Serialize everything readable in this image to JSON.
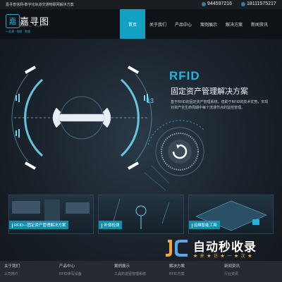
{
  "topbar": {
    "slogan": "嘉寻普信网-数字化轨道交通物联网解决方案",
    "phone1": "9445972​16",
    "phone2": "18111575217"
  },
  "logo": {
    "name": "嘉寻图",
    "en": "SHEUTA .COM",
    "tagline": "一追溯 · 物联 · 数据"
  },
  "nav": {
    "items": [
      {
        "label": "首页",
        "active": true
      },
      {
        "label": "关于我们",
        "active": false
      },
      {
        "label": "产品中心",
        "active": false
      },
      {
        "label": "案例展示",
        "active": false
      },
      {
        "label": "解决方案",
        "active": false
      },
      {
        "label": "新闻资讯",
        "active": false
      }
    ]
  },
  "hero": {
    "title_en": "RFID",
    "title_cn": "固定资产管理解决方案",
    "desc": "基于RFID的固定资产管理系统，借助于RFID的技术优势，实现对资产全生命周期中每个流通节点的监控管理。",
    "dial_number": "13",
    "accent": "#1fb6e0"
  },
  "cards": [
    {
      "label": "RFID—固定资产管理解决方案"
    },
    {
      "label": "补偿检测"
    },
    {
      "label": "运维智能工具"
    }
  ],
  "footer": {
    "cols": [
      {
        "head": "关于我们",
        "l1": "公司简介",
        "l2": ""
      },
      {
        "head": "产品中心",
        "l1": "RFID读写设备",
        "l2": ""
      },
      {
        "head": "案例展示",
        "l1": "工具防遗留管理系统",
        "l2": ""
      },
      {
        "head": "解决方案",
        "l1": "RFID方案",
        "l2": ""
      },
      {
        "head": "新闻资讯",
        "l1": "行业资讯",
        "l2": ""
      }
    ]
  },
  "watermark": {
    "brand": "自动秒收录",
    "sub": "★ 来 ★ 访 ★ 一 ★ 次 ★"
  }
}
